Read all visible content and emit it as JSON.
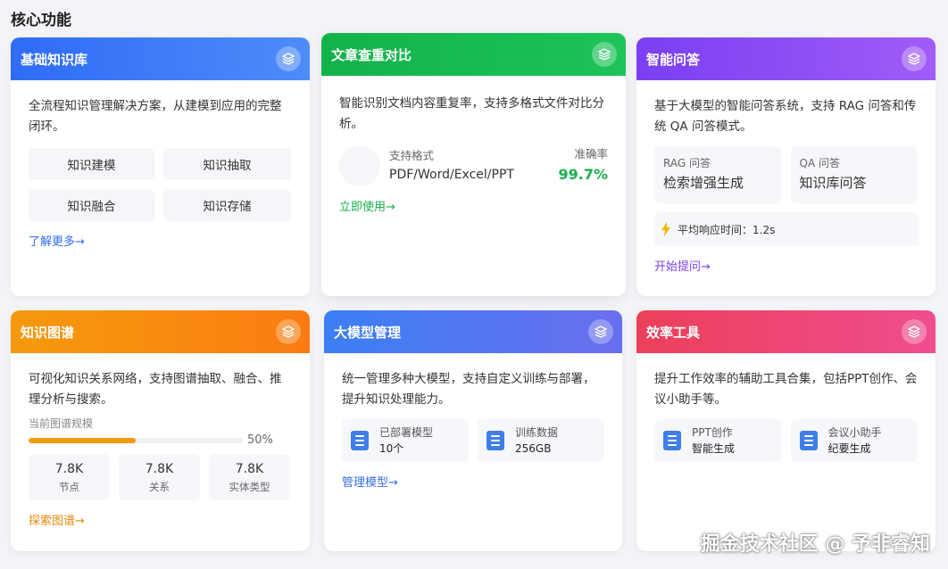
{
  "section_title": "核心功能",
  "cards": {
    "kb": {
      "title": "基础知识库",
      "desc": "全流程知识管理解决方案，从建模到应用的完整闭环。",
      "buttons": [
        "知识建模",
        "知识抽取",
        "知识融合",
        "知识存储"
      ],
      "link": "了解更多→",
      "gradient": [
        "#2f6cf6",
        "#4d8cf9"
      ],
      "link_color": "#2f6cf6"
    },
    "compare": {
      "title": "文章查重对比",
      "desc": "智能识别文档内容重复率，支持多格式文件对比分析。",
      "format_label": "支持格式",
      "format_value": "PDF/Word/Excel/PPT",
      "accuracy_label": "准确率",
      "accuracy_value": "99.7%",
      "link": "立即使用→",
      "gradient": [
        "#12b24a",
        "#1ec35a"
      ],
      "accent": "#17b04a"
    },
    "qa": {
      "title": "智能问答",
      "desc": "基于大模型的智能问答系统，支持 RAG 问答和传统 QA 问答模式。",
      "modes": [
        {
          "label": "RAG 问答",
          "value": "检索增强生成"
        },
        {
          "label": "QA 问答",
          "value": "知识库问答"
        }
      ],
      "response_label": "平均响应时间：1.2s",
      "link": "开始提问→",
      "gradient": [
        "#7b3ff2",
        "#a05cf7"
      ],
      "link_color": "#7b3ff2"
    },
    "graph": {
      "title": "知识图谱",
      "desc": "可视化知识关系网络，支持图谱抽取、融合、推理分析与搜索。",
      "scale_label": "当前图谱规模",
      "progress": 0.5,
      "progress_text": "50%",
      "stats": [
        {
          "value": "7.8K",
          "label": "节点"
        },
        {
          "value": "7.8K",
          "label": "关系"
        },
        {
          "value": "7.8K",
          "label": "实体类型"
        }
      ],
      "link": "探索图谱→",
      "gradient": [
        "#f59a0c",
        "#fb7c12"
      ],
      "link_color": "#e08a0a"
    },
    "llm": {
      "title": "大模型管理",
      "desc": "统一管理多种大模型，支持自定义训练与部署，提升知识处理能力。",
      "items": [
        {
          "label": "已部署模型",
          "value": "10个"
        },
        {
          "label": "训练数据",
          "value": "256GB"
        }
      ],
      "link": "管理模型→",
      "gradient": [
        "#3b7ff2",
        "#6a6ef0"
      ],
      "link_color": "#3b6fe0"
    },
    "tools": {
      "title": "效率工具",
      "desc": "提升工作效率的辅助工具合集，包括PPT创作、会议小助手等。",
      "items": [
        {
          "label": "PPT创作",
          "value": "智能生成"
        },
        {
          "label": "会议小助手",
          "value": "纪要生成"
        }
      ],
      "gradient": [
        "#ec3f5a",
        "#ef4e8f"
      ]
    }
  },
  "watermark": "掘金技术社区 @ 予非睿知"
}
